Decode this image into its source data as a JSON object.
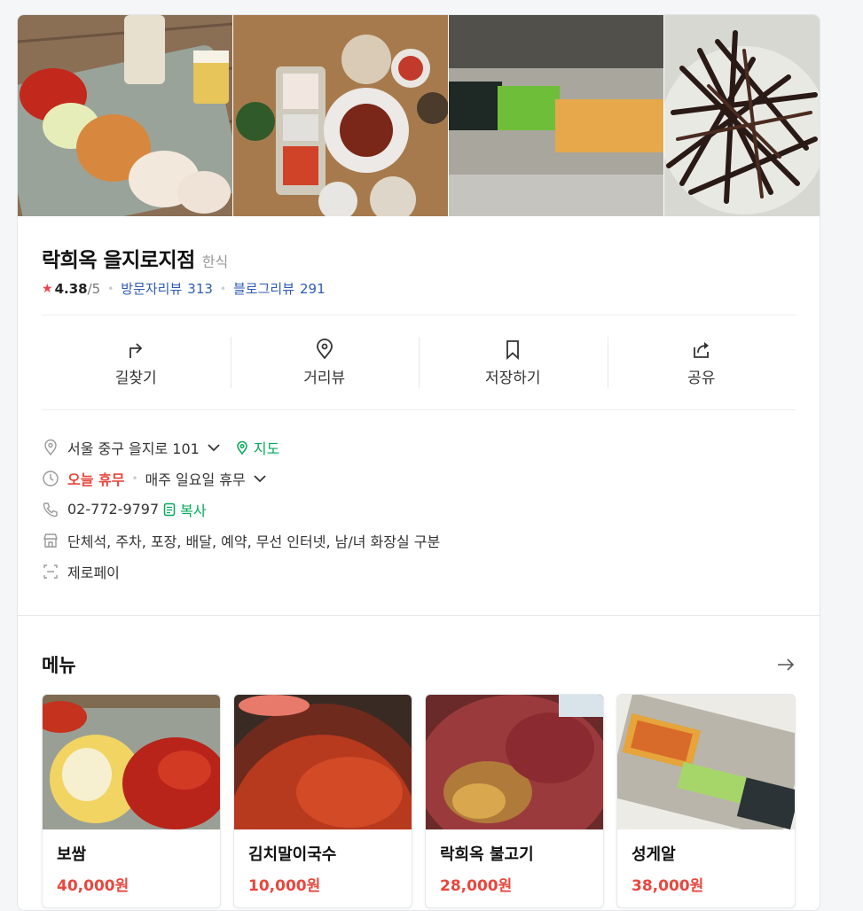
{
  "place": {
    "name": "락희옥 을지로지점",
    "category": "한식",
    "rating": "4.38",
    "rating_max": "/5",
    "visitor_review_label": "방문자리뷰",
    "visitor_review_count": "313",
    "blog_review_label": "블로그리뷰",
    "blog_review_count": "291"
  },
  "actions": [
    {
      "label": "길찾기",
      "icon": "directions-icon"
    },
    {
      "label": "거리뷰",
      "icon": "street-view-icon"
    },
    {
      "label": "저장하기",
      "icon": "bookmark-icon"
    },
    {
      "label": "공유",
      "icon": "share-icon"
    }
  ],
  "info": {
    "address": "서울 중구 을지로 101",
    "map_label": "지도",
    "status": "오늘 휴무",
    "hours": "매주 일요일 휴무",
    "phone": "02-772-9797",
    "copy_label": "복사",
    "amenities": "단체석, 주차, 포장, 배달, 예약, 무선 인터넷, 남/녀 화장실 구분",
    "payment": "제로페이"
  },
  "menu": {
    "title": "메뉴",
    "items": [
      {
        "name": "보쌈",
        "price": "40,000원"
      },
      {
        "name": "김치말이국수",
        "price": "10,000원"
      },
      {
        "name": "락희옥 불고기",
        "price": "28,000원"
      },
      {
        "name": "성게알",
        "price": "38,000원"
      }
    ]
  },
  "colors": {
    "accent_green": "#03aa5a",
    "price_red": "#e8473e",
    "link_blue": "#2e5bb5",
    "star_red": "#f0424c"
  }
}
